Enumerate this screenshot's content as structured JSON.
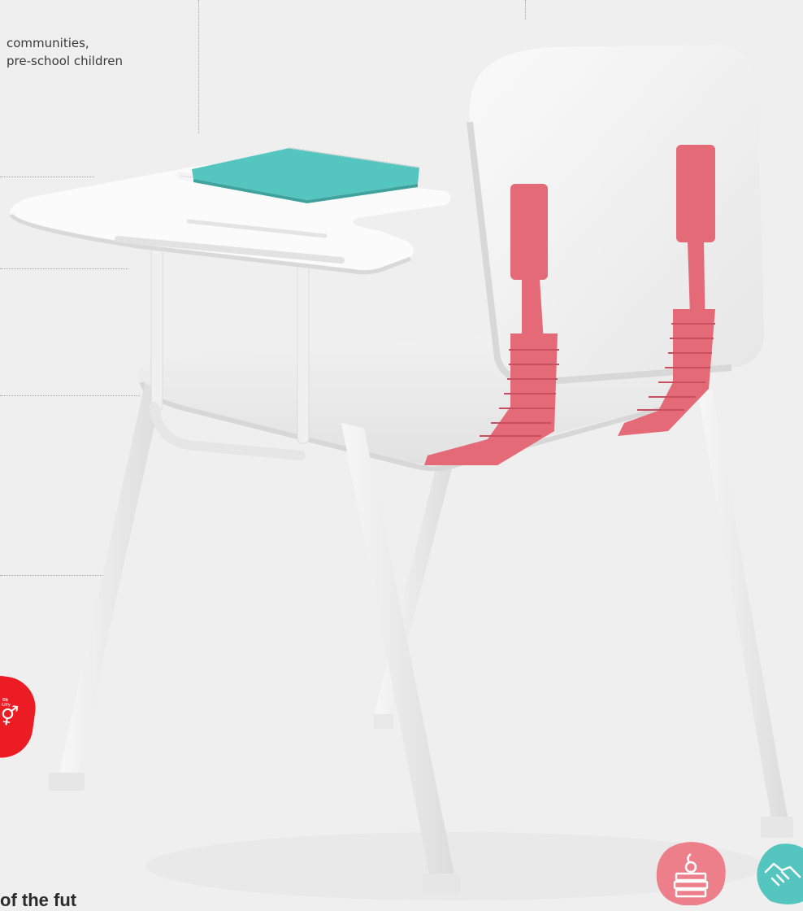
{
  "intro": {
    "line1": "communities,",
    "line2": "pre-school children"
  },
  "sdg_badge": {
    "line1": "ER",
    "line2": "LITY",
    "symbol": "⚥"
  },
  "bottom_text": "of the fut",
  "colors": {
    "background": "#efefef",
    "chair_white": "#f6f6f6",
    "strap_pink": "#e46a78",
    "notebook_teal": "#54c6bf",
    "sdg_red": "#ec1c24",
    "icon_pink": "#ec7f8a",
    "icon_teal": "#54c6bf"
  },
  "icons": [
    "books-apple-icon",
    "handshake-icon"
  ]
}
